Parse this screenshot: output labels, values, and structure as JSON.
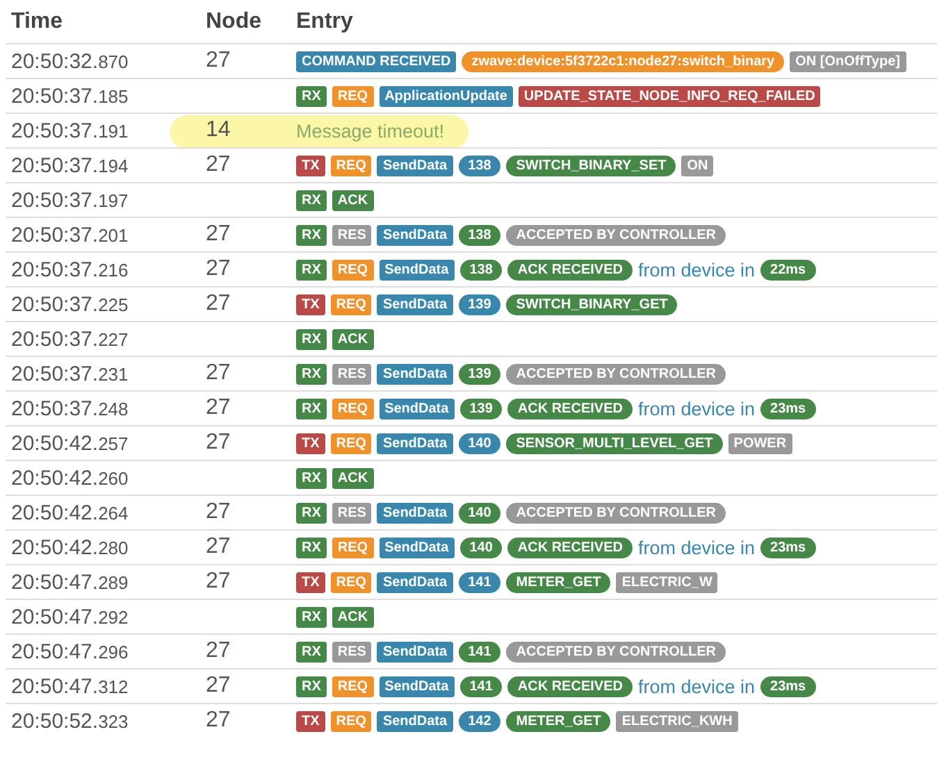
{
  "columns": [
    "Time",
    "Node",
    "Entry"
  ],
  "rows": [
    {
      "time": "20:50:32.",
      "ms": "870",
      "node": "27",
      "highlighted": false,
      "entry": [
        {
          "kind": "tag",
          "text": "COMMAND RECEIVED",
          "color": "#3a87ad"
        },
        {
          "kind": "pill",
          "text": "zwave:device:5f3722c1:node27:switch_binary",
          "color": "#f0922b"
        },
        {
          "kind": "tag",
          "text": "ON [OnOffType]",
          "color": "#999999"
        }
      ]
    },
    {
      "time": "20:50:37.",
      "ms": "185",
      "highlighted": false,
      "entry": [
        {
          "kind": "tag",
          "text": "RX",
          "color": "#468847"
        },
        {
          "kind": "tag",
          "text": "REQ",
          "color": "#f0922b"
        },
        {
          "kind": "tag",
          "text": "ApplicationUpdate",
          "color": "#3a87ad"
        },
        {
          "kind": "tag",
          "text": "UPDATE_STATE_NODE_INFO_REQ_FAILED",
          "color": "#b94a48"
        }
      ]
    },
    {
      "time": "20:50:37.",
      "ms": "191",
      "node": "14",
      "highlighted": true,
      "entry": [
        {
          "kind": "note",
          "text": "Message timeout!"
        }
      ]
    },
    {
      "time": "20:50:37.",
      "ms": "194",
      "node": "27",
      "highlighted": false,
      "entry": [
        {
          "kind": "tag",
          "text": "TX",
          "color": "#b94a48"
        },
        {
          "kind": "tag",
          "text": "REQ",
          "color": "#f0922b"
        },
        {
          "kind": "tag",
          "text": "SendData",
          "color": "#3a87ad"
        },
        {
          "kind": "pill",
          "text": "138",
          "color": "#3a87ad"
        },
        {
          "kind": "pill",
          "text": "SWITCH_BINARY_SET",
          "color": "#468847"
        },
        {
          "kind": "tag",
          "text": "ON",
          "color": "#999999"
        }
      ]
    },
    {
      "time": "20:50:37.",
      "ms": "197",
      "highlighted": false,
      "entry": [
        {
          "kind": "tag",
          "text": "RX",
          "color": "#468847"
        },
        {
          "kind": "tag",
          "text": "ACK",
          "color": "#468847"
        }
      ]
    },
    {
      "time": "20:50:37.",
      "ms": "201",
      "node": "27",
      "highlighted": false,
      "entry": [
        {
          "kind": "tag",
          "text": "RX",
          "color": "#468847"
        },
        {
          "kind": "tag",
          "text": "RES",
          "color": "#999999"
        },
        {
          "kind": "tag",
          "text": "SendData",
          "color": "#3a87ad"
        },
        {
          "kind": "pill",
          "text": "138",
          "color": "#468847"
        },
        {
          "kind": "pill",
          "text": "ACCEPTED BY CONTROLLER",
          "color": "#999999"
        }
      ]
    },
    {
      "time": "20:50:37.",
      "ms": "216",
      "node": "27",
      "highlighted": false,
      "entry": [
        {
          "kind": "tag",
          "text": "RX",
          "color": "#468847"
        },
        {
          "kind": "tag",
          "text": "REQ",
          "color": "#f0922b"
        },
        {
          "kind": "tag",
          "text": "SendData",
          "color": "#3a87ad"
        },
        {
          "kind": "pill",
          "text": "138",
          "color": "#468847"
        },
        {
          "kind": "pill",
          "text": "ACK RECEIVED",
          "color": "#468847"
        },
        {
          "kind": "text",
          "text": "from device in"
        },
        {
          "kind": "pill",
          "text": "22ms",
          "color": "#468847"
        }
      ]
    },
    {
      "time": "20:50:37.",
      "ms": "225",
      "node": "27",
      "highlighted": false,
      "entry": [
        {
          "kind": "tag",
          "text": "TX",
          "color": "#b94a48"
        },
        {
          "kind": "tag",
          "text": "REQ",
          "color": "#f0922b"
        },
        {
          "kind": "tag",
          "text": "SendData",
          "color": "#3a87ad"
        },
        {
          "kind": "pill",
          "text": "139",
          "color": "#3a87ad"
        },
        {
          "kind": "pill",
          "text": "SWITCH_BINARY_GET",
          "color": "#468847"
        }
      ]
    },
    {
      "time": "20:50:37.",
      "ms": "227",
      "highlighted": false,
      "entry": [
        {
          "kind": "tag",
          "text": "RX",
          "color": "#468847"
        },
        {
          "kind": "tag",
          "text": "ACK",
          "color": "#468847"
        }
      ]
    },
    {
      "time": "20:50:37.",
      "ms": "231",
      "node": "27",
      "highlighted": false,
      "entry": [
        {
          "kind": "tag",
          "text": "RX",
          "color": "#468847"
        },
        {
          "kind": "tag",
          "text": "RES",
          "color": "#999999"
        },
        {
          "kind": "tag",
          "text": "SendData",
          "color": "#3a87ad"
        },
        {
          "kind": "pill",
          "text": "139",
          "color": "#468847"
        },
        {
          "kind": "pill",
          "text": "ACCEPTED BY CONTROLLER",
          "color": "#999999"
        }
      ]
    },
    {
      "time": "20:50:37.",
      "ms": "248",
      "node": "27",
      "highlighted": false,
      "entry": [
        {
          "kind": "tag",
          "text": "RX",
          "color": "#468847"
        },
        {
          "kind": "tag",
          "text": "REQ",
          "color": "#f0922b"
        },
        {
          "kind": "tag",
          "text": "SendData",
          "color": "#3a87ad"
        },
        {
          "kind": "pill",
          "text": "139",
          "color": "#468847"
        },
        {
          "kind": "pill",
          "text": "ACK RECEIVED",
          "color": "#468847"
        },
        {
          "kind": "text",
          "text": "from device in"
        },
        {
          "kind": "pill",
          "text": "23ms",
          "color": "#468847"
        }
      ]
    },
    {
      "time": "20:50:42.",
      "ms": "257",
      "node": "27",
      "highlighted": false,
      "entry": [
        {
          "kind": "tag",
          "text": "TX",
          "color": "#b94a48"
        },
        {
          "kind": "tag",
          "text": "REQ",
          "color": "#f0922b"
        },
        {
          "kind": "tag",
          "text": "SendData",
          "color": "#3a87ad"
        },
        {
          "kind": "pill",
          "text": "140",
          "color": "#3a87ad"
        },
        {
          "kind": "pill",
          "text": "SENSOR_MULTI_LEVEL_GET",
          "color": "#468847"
        },
        {
          "kind": "tag",
          "text": "POWER",
          "color": "#999999"
        }
      ]
    },
    {
      "time": "20:50:42.",
      "ms": "260",
      "highlighted": false,
      "entry": [
        {
          "kind": "tag",
          "text": "RX",
          "color": "#468847"
        },
        {
          "kind": "tag",
          "text": "ACK",
          "color": "#468847"
        }
      ]
    },
    {
      "time": "20:50:42.",
      "ms": "264",
      "node": "27",
      "highlighted": false,
      "entry": [
        {
          "kind": "tag",
          "text": "RX",
          "color": "#468847"
        },
        {
          "kind": "tag",
          "text": "RES",
          "color": "#999999"
        },
        {
          "kind": "tag",
          "text": "SendData",
          "color": "#3a87ad"
        },
        {
          "kind": "pill",
          "text": "140",
          "color": "#468847"
        },
        {
          "kind": "pill",
          "text": "ACCEPTED BY CONTROLLER",
          "color": "#999999"
        }
      ]
    },
    {
      "time": "20:50:42.",
      "ms": "280",
      "node": "27",
      "highlighted": false,
      "entry": [
        {
          "kind": "tag",
          "text": "RX",
          "color": "#468847"
        },
        {
          "kind": "tag",
          "text": "REQ",
          "color": "#f0922b"
        },
        {
          "kind": "tag",
          "text": "SendData",
          "color": "#3a87ad"
        },
        {
          "kind": "pill",
          "text": "140",
          "color": "#468847"
        },
        {
          "kind": "pill",
          "text": "ACK RECEIVED",
          "color": "#468847"
        },
        {
          "kind": "text",
          "text": "from device in"
        },
        {
          "kind": "pill",
          "text": "23ms",
          "color": "#468847"
        }
      ]
    },
    {
      "time": "20:50:47.",
      "ms": "289",
      "node": "27",
      "highlighted": false,
      "entry": [
        {
          "kind": "tag",
          "text": "TX",
          "color": "#b94a48"
        },
        {
          "kind": "tag",
          "text": "REQ",
          "color": "#f0922b"
        },
        {
          "kind": "tag",
          "text": "SendData",
          "color": "#3a87ad"
        },
        {
          "kind": "pill",
          "text": "141",
          "color": "#3a87ad"
        },
        {
          "kind": "pill",
          "text": "METER_GET",
          "color": "#468847"
        },
        {
          "kind": "tag",
          "text": "ELECTRIC_W",
          "color": "#999999"
        }
      ]
    },
    {
      "time": "20:50:47.",
      "ms": "292",
      "highlighted": false,
      "entry": [
        {
          "kind": "tag",
          "text": "RX",
          "color": "#468847"
        },
        {
          "kind": "tag",
          "text": "ACK",
          "color": "#468847"
        }
      ]
    },
    {
      "time": "20:50:47.",
      "ms": "296",
      "node": "27",
      "highlighted": false,
      "entry": [
        {
          "kind": "tag",
          "text": "RX",
          "color": "#468847"
        },
        {
          "kind": "tag",
          "text": "RES",
          "color": "#999999"
        },
        {
          "kind": "tag",
          "text": "SendData",
          "color": "#3a87ad"
        },
        {
          "kind": "pill",
          "text": "141",
          "color": "#468847"
        },
        {
          "kind": "pill",
          "text": "ACCEPTED BY CONTROLLER",
          "color": "#999999"
        }
      ]
    },
    {
      "time": "20:50:47.",
      "ms": "312",
      "node": "27",
      "highlighted": false,
      "entry": [
        {
          "kind": "tag",
          "text": "RX",
          "color": "#468847"
        },
        {
          "kind": "tag",
          "text": "REQ",
          "color": "#f0922b"
        },
        {
          "kind": "tag",
          "text": "SendData",
          "color": "#3a87ad"
        },
        {
          "kind": "pill",
          "text": "141",
          "color": "#468847"
        },
        {
          "kind": "pill",
          "text": "ACK RECEIVED",
          "color": "#468847"
        },
        {
          "kind": "text",
          "text": "from device in"
        },
        {
          "kind": "pill",
          "text": "23ms",
          "color": "#468847"
        }
      ]
    },
    {
      "time": "20:50:52.",
      "ms": "323",
      "node": "27",
      "highlighted": false,
      "entry": [
        {
          "kind": "tag",
          "text": "TX",
          "color": "#b94a48"
        },
        {
          "kind": "tag",
          "text": "REQ",
          "color": "#f0922b"
        },
        {
          "kind": "tag",
          "text": "SendData",
          "color": "#3a87ad"
        },
        {
          "kind": "pill",
          "text": "142",
          "color": "#3a87ad"
        },
        {
          "kind": "pill",
          "text": "METER_GET",
          "color": "#468847"
        },
        {
          "kind": "tag",
          "text": "ELECTRIC_KWH",
          "color": "#999999"
        }
      ]
    }
  ]
}
